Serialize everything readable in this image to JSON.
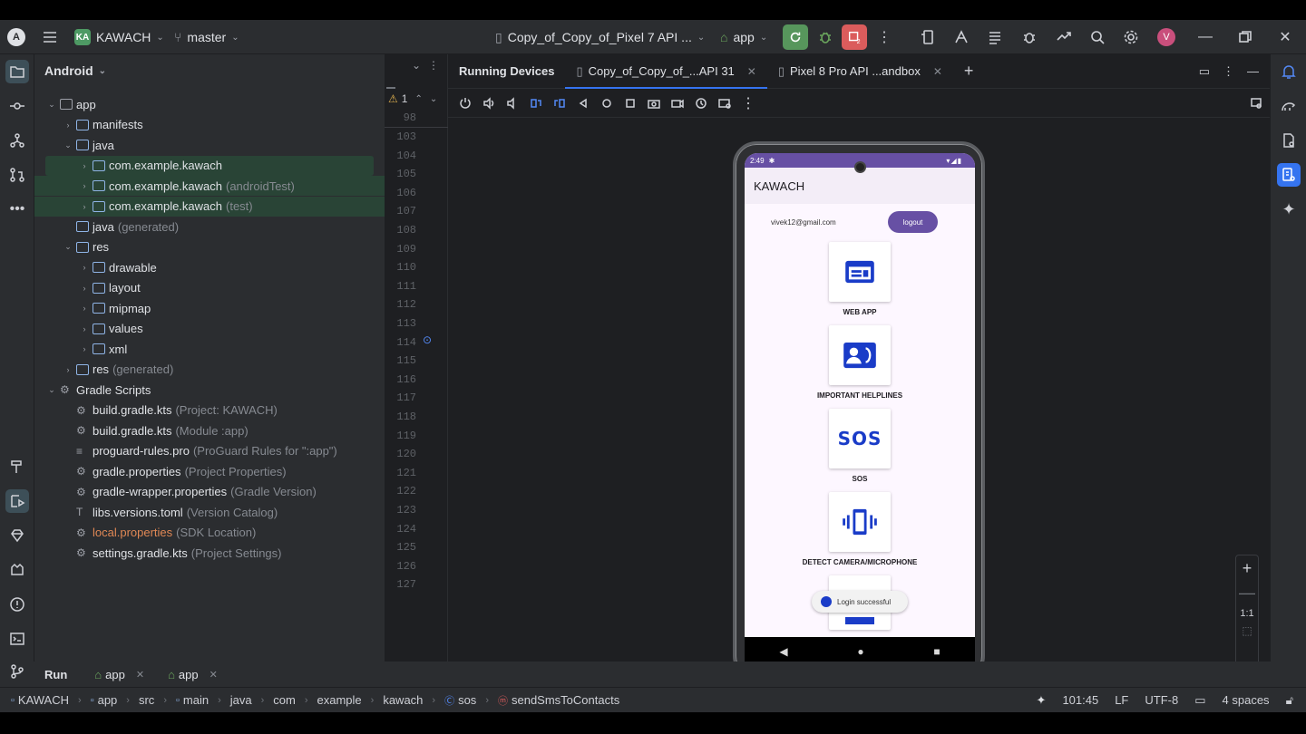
{
  "topbar": {
    "project_badge": "KA",
    "project_name": "KAWACH",
    "branch": "master",
    "device": "Copy_of_Copy_of_Pixel 7 API ...",
    "run_config": "app",
    "avatar": "V"
  },
  "project_panel": {
    "title": "Android",
    "tree": [
      {
        "label": "app",
        "extra": "",
        "depth": 0,
        "expanded": true,
        "icon": "module"
      },
      {
        "label": "manifests",
        "extra": "",
        "depth": 1,
        "expanded": false,
        "icon": "folder"
      },
      {
        "label": "java",
        "extra": "",
        "depth": 1,
        "expanded": true,
        "icon": "folder"
      },
      {
        "label": "com.example.kawach",
        "extra": "",
        "depth": 2,
        "expanded": false,
        "icon": "package"
      },
      {
        "label": "com.example.kawach",
        "extra": "(androidTest)",
        "depth": 2,
        "expanded": false,
        "icon": "package"
      },
      {
        "label": "com.example.kawach",
        "extra": "(test)",
        "depth": 2,
        "expanded": false,
        "icon": "package"
      },
      {
        "label": "java",
        "extra": "(generated)",
        "depth": 1,
        "expanded": null,
        "icon": "folder"
      },
      {
        "label": "res",
        "extra": "",
        "depth": 1,
        "expanded": true,
        "icon": "folder"
      },
      {
        "label": "drawable",
        "extra": "",
        "depth": 2,
        "expanded": false,
        "icon": "package"
      },
      {
        "label": "layout",
        "extra": "",
        "depth": 2,
        "expanded": false,
        "icon": "package"
      },
      {
        "label": "mipmap",
        "extra": "",
        "depth": 2,
        "expanded": false,
        "icon": "package"
      },
      {
        "label": "values",
        "extra": "",
        "depth": 2,
        "expanded": false,
        "icon": "package"
      },
      {
        "label": "xml",
        "extra": "",
        "depth": 2,
        "expanded": false,
        "icon": "package"
      },
      {
        "label": "res",
        "extra": "(generated)",
        "depth": 1,
        "expanded": false,
        "icon": "folder"
      },
      {
        "label": "Gradle Scripts",
        "extra": "",
        "depth": 0,
        "expanded": true,
        "icon": "gradle"
      },
      {
        "label": "build.gradle.kts",
        "extra": "(Project: KAWACH)",
        "depth": 1,
        "expanded": null,
        "icon": "gradle"
      },
      {
        "label": "build.gradle.kts",
        "extra": "(Module :app)",
        "depth": 1,
        "expanded": null,
        "icon": "gradle"
      },
      {
        "label": "proguard-rules.pro",
        "extra": "(ProGuard Rules for \":app\")",
        "depth": 1,
        "expanded": null,
        "icon": "text"
      },
      {
        "label": "gradle.properties",
        "extra": "(Project Properties)",
        "depth": 1,
        "expanded": null,
        "icon": "gear"
      },
      {
        "label": "gradle-wrapper.properties",
        "extra": "(Gradle Version)",
        "depth": 1,
        "expanded": null,
        "icon": "gear"
      },
      {
        "label": "libs.versions.toml",
        "extra": "(Version Catalog)",
        "depth": 1,
        "expanded": null,
        "icon": "toml"
      },
      {
        "label": "local.properties",
        "extra": "(SDK Location)",
        "depth": 1,
        "expanded": null,
        "icon": "gear"
      },
      {
        "label": "settings.gradle.kts",
        "extra": "(Project Settings)",
        "depth": 1,
        "expanded": null,
        "icon": "gradle"
      }
    ]
  },
  "editor": {
    "warning_count": "1",
    "line_numbers": [
      "98",
      "103",
      "104",
      "105",
      "106",
      "107",
      "108",
      "109",
      "110",
      "111",
      "112",
      "113",
      "114",
      "115",
      "116",
      "117",
      "118",
      "119",
      "120",
      "121",
      "122",
      "123",
      "124",
      "125",
      "126",
      "127"
    ]
  },
  "devices": {
    "title": "Running Devices",
    "tabs": [
      {
        "label": "Copy_of_Copy_of_...API 31",
        "active": true
      },
      {
        "label": "Pixel 8 Pro API ...andbox",
        "active": false
      }
    ],
    "zoom_label": "1:1"
  },
  "phone": {
    "time": "2:49",
    "app_title": "KAWACH",
    "email": "vivek12@gmail.com",
    "logout": "logout",
    "tiles": [
      {
        "label": "WEB APP",
        "icon": "web-app-icon"
      },
      {
        "label": "IMPORTANT HELPLINES",
        "icon": "contact-phone-icon"
      },
      {
        "label": "SOS",
        "icon": "sos-icon"
      },
      {
        "label": "DETECT CAMERA/MICROPHONE",
        "icon": "vibration-icon"
      }
    ],
    "toast": "Login successful",
    "accent": "#6750a4",
    "icon_blue": "#1a3cc8"
  },
  "run_bar": {
    "title": "Run",
    "tabs": [
      "app",
      "app"
    ]
  },
  "status": {
    "breadcrumbs": [
      "KAWACH",
      "app",
      "src",
      "main",
      "java",
      "com",
      "example",
      "kawach",
      "sos",
      "sendSmsToContacts"
    ],
    "position": "101:45",
    "line_sep": "LF",
    "encoding": "UTF-8",
    "indent": "4 spaces"
  }
}
